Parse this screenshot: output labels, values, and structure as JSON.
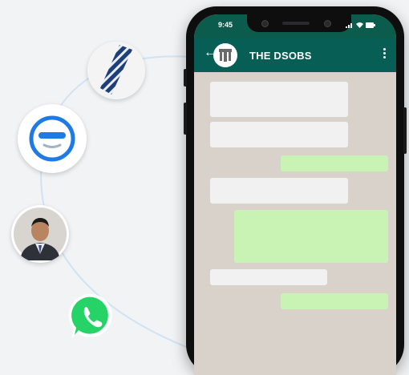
{
  "status_bar": {
    "time": "9:45"
  },
  "chat": {
    "title": "THE DSOBS",
    "back_icon": "arrow-left-icon",
    "menu_icon": "more-vertical-icon"
  },
  "side_icons": [
    "striped-tie-icon",
    "minus-smile-logo-icon",
    "person-photo-avatar",
    "whatsapp-icon"
  ],
  "colors": {
    "header": "#075e54",
    "status_bar": "#0b5c4c",
    "chat_background": "#d8d2ca",
    "incoming_bubble": "#f1f1f1",
    "outgoing_bubble": "#c9f3b5",
    "whatsapp_green": "#25d366",
    "logo_blue": "#1e7be6"
  }
}
